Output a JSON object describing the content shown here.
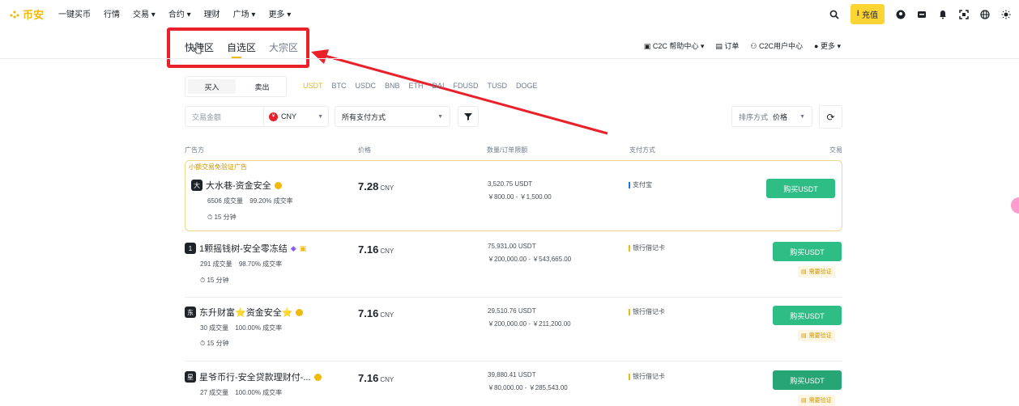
{
  "brand": {
    "name": "币安"
  },
  "nav": {
    "items": [
      "一键买币",
      "行情",
      "交易 ▾",
      "合约 ▾",
      "理财",
      "广场 ▾",
      "更多 ▾"
    ]
  },
  "header_right": {
    "deposit_label": "充值"
  },
  "tabs": [
    {
      "label": "快捷区"
    },
    {
      "label": "自选区"
    },
    {
      "label": "大宗区"
    }
  ],
  "c2c_links": [
    "C2C 帮助中心 ▾",
    "订单",
    "C2C用户中心",
    "更多 ▾"
  ],
  "buysell": {
    "buy": "买入",
    "sell": "卖出"
  },
  "coins": [
    "USDT",
    "BTC",
    "USDC",
    "BNB",
    "ETH",
    "DAI",
    "FDUSD",
    "TUSD",
    "DOGE"
  ],
  "filters": {
    "amount_placeholder": "交易金额",
    "currency": "CNY",
    "payment": "所有支付方式",
    "sort_label": "排序方式",
    "sort_value": "价格"
  },
  "columns": {
    "advertiser": "广告方",
    "price": "价格",
    "amount": "数量/订单限额",
    "payment": "支付方式",
    "trade": "交易"
  },
  "promo_label": "小额交易免验证广告",
  "listings": [
    {
      "avatar": "大",
      "name": "大水巷-资金安全",
      "orders": "6506 成交量",
      "rate": "99.20% 成交率",
      "time": "15 分钟",
      "price": "7.28",
      "currency": "CNY",
      "qty": "3,520.75 USDT",
      "limit": "￥800.00 - ￥1,500.00",
      "payment": "支付宝",
      "button": "购买USDT",
      "verify": ""
    },
    {
      "avatar": "1",
      "name": "1颗摇钱树-安全零冻结",
      "orders": "291 成交量",
      "rate": "98.70% 成交率",
      "time": "15 分钟",
      "price": "7.16",
      "currency": "CNY",
      "qty": "75,931.00 USDT",
      "limit": "￥200,000.00 - ￥543,665.00",
      "payment": "银行借记卡",
      "button": "购买USDT",
      "verify": "需要验证"
    },
    {
      "avatar": "东",
      "name": "东升财富⭐资金安全⭐",
      "orders": "30 成交量",
      "rate": "100.00% 成交率",
      "time": "15 分钟",
      "price": "7.16",
      "currency": "CNY",
      "qty": "29,510.76 USDT",
      "limit": "￥200,000.00 - ￥211,200.00",
      "payment": "银行借记卡",
      "button": "购买USDT",
      "verify": "需要验证"
    },
    {
      "avatar": "星",
      "name": "星爷币行-安全贷款理财付-...",
      "orders": "27 成交量",
      "rate": "100.00% 成交率",
      "time": "",
      "price": "7.16",
      "currency": "CNY",
      "qty": "39,880.41 USDT",
      "limit": "￥80,000.00 - ￥285,543.00",
      "payment": "银行借记卡",
      "button": "购买USDT",
      "verify": "需要验证"
    }
  ],
  "colors": {
    "accent": "#f0b90b",
    "buy": "#2ebd85",
    "annotation": "#e8212b"
  }
}
